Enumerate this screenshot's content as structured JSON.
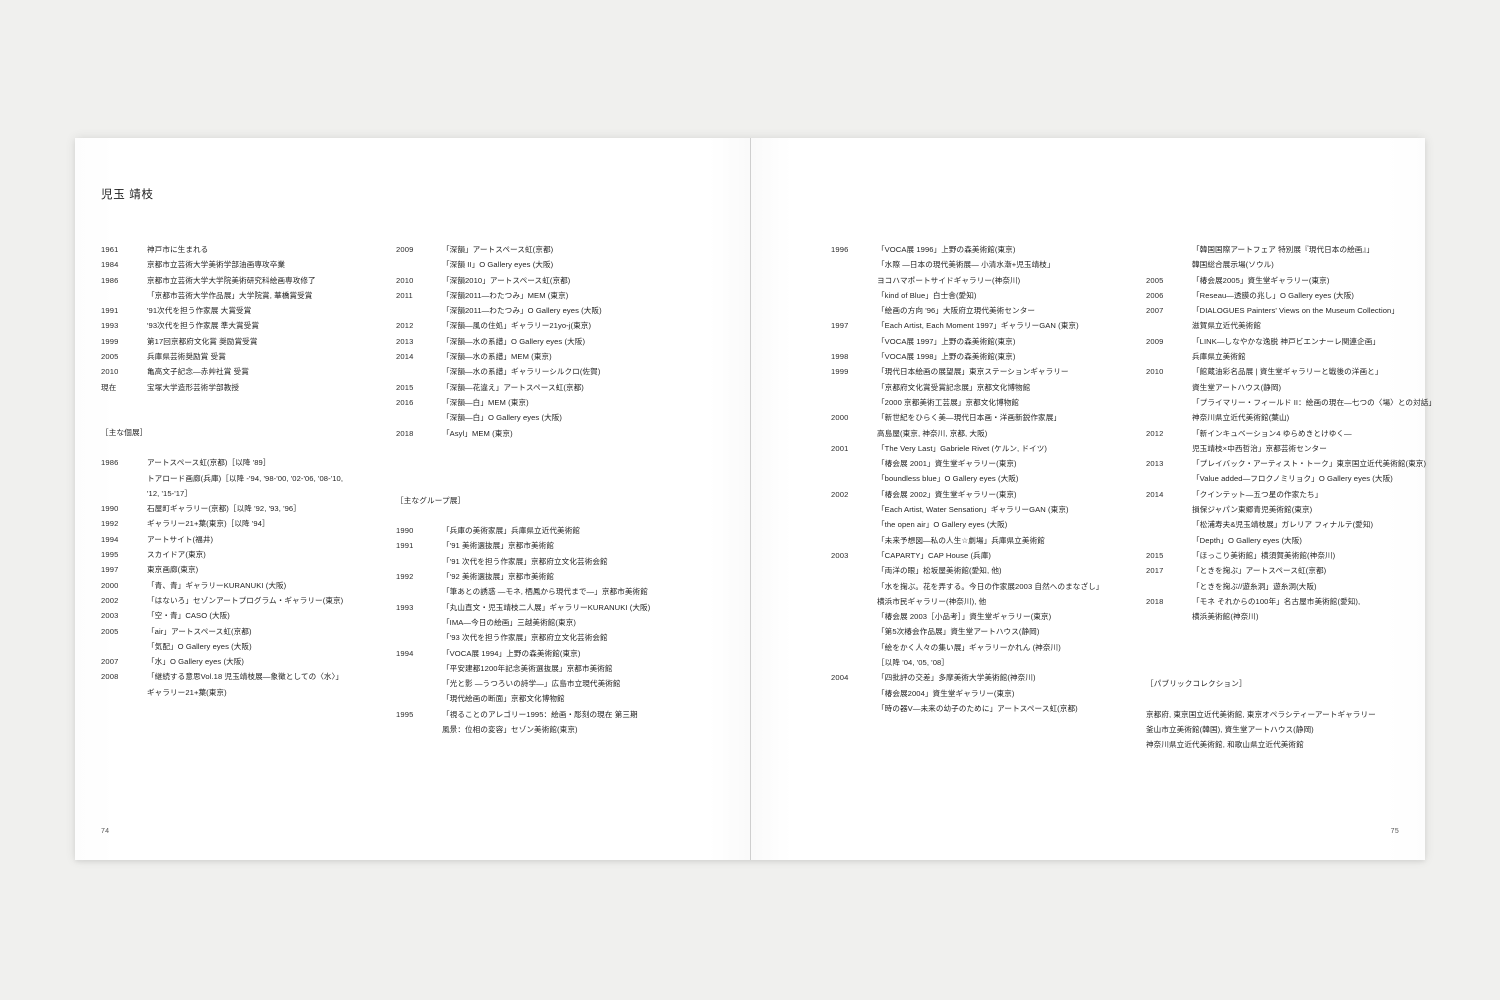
{
  "document": {
    "artist_name": "児玉 靖枝",
    "folio_left": "74",
    "folio_right": "75"
  },
  "headings": {
    "solo": "［主な個展］",
    "group": "［主なグループ展］",
    "public_collection": "［パブリックコレクション］"
  },
  "biography": [
    {
      "year": "1961",
      "lines": [
        "神戸市に生まれる"
      ]
    },
    {
      "year": "1984",
      "lines": [
        "京都市立芸術大学美術学部油画専攻卒業"
      ]
    },
    {
      "year": "1986",
      "lines": [
        "京都市立芸術大学大学院美術研究科絵画専攻修了",
        "「京都市芸術大学作品展」大学院賞, 華橋賞受賞"
      ]
    },
    {
      "year": "1991",
      "lines": [
        "'91次代を担う作家展 大賞受賞"
      ]
    },
    {
      "year": "1993",
      "lines": [
        "'93次代を担う作家展 準大賞受賞"
      ]
    },
    {
      "year": "1999",
      "lines": [
        "第17回京都府文化賞 奨励賞受賞"
      ]
    },
    {
      "year": "2005",
      "lines": [
        "兵庫県芸術奨励賞 受賞"
      ]
    },
    {
      "year": "2010",
      "lines": [
        "亀高文子記念—赤艸社賞 受賞"
      ]
    },
    {
      "year": "現在",
      "lines": [
        "宝塚大学造形芸術学部教授"
      ]
    }
  ],
  "solo_exhibitions_col1": [
    {
      "year": "1986",
      "lines": [
        "アートスペース虹(京都)［以降 '89］",
        "トアロード画廊(兵庫)［以降 -'94, '98-'00, '02-'06, '08-'10,",
        "'12, '15-'17］"
      ]
    },
    {
      "year": "1990",
      "lines": [
        "石屋町ギャラリー(京都)［以降 '92, '93, '96］"
      ]
    },
    {
      "year": "1992",
      "lines": [
        "ギャラリー21+葉(東京)［以降 '94］"
      ]
    },
    {
      "year": "1994",
      "lines": [
        "アートサイト(福井)"
      ]
    },
    {
      "year": "1995",
      "lines": [
        "スカイドア(東京)"
      ]
    },
    {
      "year": "1997",
      "lines": [
        "東京画廊(東京)"
      ]
    },
    {
      "year": "2000",
      "lines": [
        "「青、青」ギャラリーKURANUKI (大阪)"
      ]
    },
    {
      "year": "2002",
      "lines": [
        "「はないろ」セゾンアートプログラム・ギャラリー(東京)"
      ]
    },
    {
      "year": "2003",
      "lines": [
        "「空・青」CASO (大阪)"
      ]
    },
    {
      "year": "2005",
      "lines": [
        "「air」アートスペース虹(京都)",
        "「気配」O Gallery eyes (大阪)"
      ]
    },
    {
      "year": "2007",
      "lines": [
        "「水」O Gallery eyes (大阪)"
      ]
    },
    {
      "year": "2008",
      "lines": [
        "「継続する意思Vol.18 児玉靖枝展—象徴としての〈水〉」",
        "ギャラリー21+葉(東京)"
      ]
    }
  ],
  "solo_exhibitions_col2": [
    {
      "year": "2009",
      "lines": [
        "「深韻」アートスペース虹(京都)",
        "「深韻 II」O Gallery eyes (大阪)"
      ]
    },
    {
      "year": "2010",
      "lines": [
        "「深韻2010」アートスペース虹(京都)"
      ]
    },
    {
      "year": "2011",
      "lines": [
        "「深韻2011—わたつみ」MEM (東京)",
        "「深韻2011—わたつみ」O Gallery eyes (大阪)"
      ]
    },
    {
      "year": "2012",
      "lines": [
        "「深韻—風の住処」ギャラリー21yo-j(東京)"
      ]
    },
    {
      "year": "2013",
      "lines": [
        "「深韻—水の系譜」O Gallery eyes (大阪)"
      ]
    },
    {
      "year": "2014",
      "lines": [
        "「深韻—水の系譜」MEM (東京)",
        "「深韻—水の系譜」ギャラリーシルクロ(佐賀)"
      ]
    },
    {
      "year": "2015",
      "lines": [
        "「深韻—花違え」アートスペース虹(京都)"
      ]
    },
    {
      "year": "2016",
      "lines": [
        "「深韻—白」MEM (東京)",
        "「深韻—白」O Gallery eyes (大阪)"
      ]
    },
    {
      "year": "2018",
      "lines": [
        "「Asyl」MEM (東京)"
      ]
    }
  ],
  "group_exhibitions_col1": [
    {
      "year": "1990",
      "lines": [
        "「兵庫の美術家展」兵庫県立近代美術館"
      ]
    },
    {
      "year": "1991",
      "lines": [
        "「'91 美術選抜展」京都市美術館",
        "「'91 次代を担う作家展」京都府立文化芸術会館"
      ]
    },
    {
      "year": "1992",
      "lines": [
        "「'92 美術選抜展」京都市美術館",
        "「筆あとの誘惑 —モネ, 栖鳳から現代まで—」京都市美術館"
      ]
    },
    {
      "year": "1993",
      "lines": [
        "「丸山直文・児玉靖枝二人展」ギャラリーKURANUKI (大阪)",
        "「IMA—今日の絵画」三越美術館(東京)",
        "「'93 次代を担う作家展」京都府立文化芸術会館"
      ]
    },
    {
      "year": "1994",
      "lines": [
        "「VOCA展 1994」上野の森美術館(東京)",
        "「平安建都1200年記念美術選抜展」京都市美術館",
        "「光と影 —うつろいの詩学—」広島市立現代美術館",
        "「現代絵画の断面」京都文化博物館"
      ]
    },
    {
      "year": "1995",
      "lines": [
        "「視ることのアレゴリー1995：絵画・彫刻の現在 第三期",
        "風景：位相の変容」セゾン美術館(東京)"
      ]
    }
  ],
  "group_exhibitions_col2": [
    {
      "year": "1996",
      "lines": [
        "「VOCA展 1996」上野の森美術館(東京)",
        "「水際 —日本の現代美術展— 小清水漸+児玉靖枝」",
        "ヨコハマポートサイドギャラリー(神奈川)",
        "「kind of Blue」白士舎(愛知)",
        "「絵画の方向 '96」大阪府立現代美術センター"
      ]
    },
    {
      "year": "1997",
      "lines": [
        "「Each Artist, Each Moment 1997」ギャラリーGAN (東京)",
        "「VOCA展 1997」上野の森美術館(東京)"
      ]
    },
    {
      "year": "1998",
      "lines": [
        "「VOCA展 1998」上野の森美術館(東京)"
      ]
    },
    {
      "year": "1999",
      "lines": [
        "「現代日本絵画の展望展」東京ステーションギャラリー",
        "「京都府文化賞受賞記念展」京都文化博物館",
        "「2000 京都美術工芸展」京都文化博物館"
      ]
    },
    {
      "year": "2000",
      "lines": [
        "「新世紀をひらく美—現代日本画・洋画新鋭作家展」",
        "高島屋(東京, 神奈川, 京都, 大阪)"
      ]
    },
    {
      "year": "2001",
      "lines": [
        "「The Very Last」Gabriele Rivet (ケルン, ドイツ)",
        "「椿会展 2001」資生堂ギャラリー(東京)",
        "「boundless blue」O Gallery eyes (大阪)"
      ]
    },
    {
      "year": "2002",
      "lines": [
        "「椿会展 2002」資生堂ギャラリー(東京)",
        "「Each Artist, Water Sensation」ギャラリーGAN (東京)",
        "「the open air」O Gallery eyes (大阪)",
        "「未来予想図—私の人生☆劇場」兵庫県立美術館"
      ]
    },
    {
      "year": "2003",
      "lines": [
        "「CAPARTY」CAP House (兵庫)",
        "「両洋の眼」松坂屋美術館(愛知, 他)",
        "「水を掬ぶ。花を弄する。今日の作家展2003 自然へのまなざし」",
        "横浜市民ギャラリー(神奈川), 他",
        "「椿会展 2003［小品考］」資生堂ギャラリー(東京)",
        "「第5次椿会作品展」資生堂アートハウス(静岡)",
        "「絵をかく人々の集い展」ギャラリーかれん (神奈川)",
        "［以降 '04, '05, '08］"
      ]
    },
    {
      "year": "2004",
      "lines": [
        "「四批評の交差」多摩美術大学美術館(神奈川)",
        "「椿会展2004」資生堂ギャラリー(東京)",
        "「時の器V—未来の幼子のために」アートスペース虹(京都)"
      ]
    }
  ],
  "group_exhibitions_col3": [
    {
      "year": "",
      "lines": [
        "「韓国国際アートフェア 特別展『現代日本の絵画』」",
        "韓国総合展示場(ソウル)"
      ]
    },
    {
      "year": "2005",
      "lines": [
        "「椿会展2005」資生堂ギャラリー(東京)"
      ]
    },
    {
      "year": "2006",
      "lines": [
        "「Reseau—透膜の兆し」O Gallery eyes (大阪)"
      ]
    },
    {
      "year": "2007",
      "lines": [
        "「DIALOGUES Painters' Views on the Museum Collection」",
        "滋賀県立近代美術館"
      ]
    },
    {
      "year": "2009",
      "lines": [
        "「LINK—しなやかな逸脱 神戸ビエンナーレ関連企画」",
        "兵庫県立美術館"
      ]
    },
    {
      "year": "2010",
      "lines": [
        "「館蔵油彩名品展 | 資生堂ギャラリーと戦後の洋画と」",
        "資生堂アートハウス(静岡)",
        "「プライマリー・フィールド II：絵画の現在—七つの〈場〉との対話」",
        "神奈川県立近代美術館(葉山)"
      ]
    },
    {
      "year": "2012",
      "lines": [
        "「新インキュベーション4 ゆらめきとけゆく—",
        "児玉靖枝×中西哲治」京都芸術センター"
      ]
    },
    {
      "year": "2013",
      "lines": [
        "「プレイバック・アーティスト・トーク」東京国立近代美術館(東京)",
        "「Value added—フロクノミリョク」O Gallery eyes (大阪)"
      ]
    },
    {
      "year": "2014",
      "lines": [
        "「クインテット—五つ星の作家たち」",
        "損保ジャパン東郷青児美術館(東京)",
        "「松浦寿夫&児玉靖枝展」ガレリア フィナルテ(愛知)",
        "「Depth」O Gallery eyes (大阪)"
      ]
    },
    {
      "year": "2015",
      "lines": [
        "「ほっこり美術館」横須賀美術館(神奈川)"
      ]
    },
    {
      "year": "2017",
      "lines": [
        "「ときを掬ぶ」アートスペース虹(京都)",
        "「ときを掬ぶ//遊糸洞」遊糸洞(大阪)"
      ]
    },
    {
      "year": "2018",
      "lines": [
        "「モネ それからの100年」名古屋市美術館(愛知),",
        "横浜美術館(神奈川)"
      ]
    }
  ],
  "public_collection": [
    "京都府, 東京国立近代美術館, 東京オペラシティーアートギャラリー",
    "釜山市立美術館(韓国), 資生堂アートハウス(静岡)",
    "神奈川県立近代美術館, 和歌山県立近代美術館"
  ]
}
